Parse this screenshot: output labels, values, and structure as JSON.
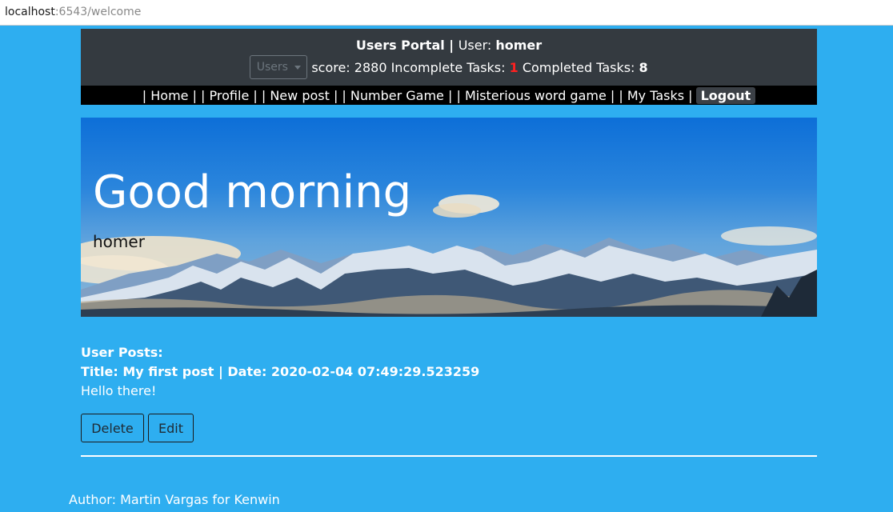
{
  "browser": {
    "url_host": "localhost",
    "url_rest": ":6543/welcome"
  },
  "header": {
    "portal_title": "Users Portal",
    "separator": " | ",
    "user_label": "User: ",
    "username": "homer",
    "users_dropdown": "Users",
    "score_label": "score: ",
    "score_value": "2880",
    "incomplete_label": " Incomplete Tasks: ",
    "incomplete_value": "1",
    "completed_label": " Completed Tasks: ",
    "completed_value": "8"
  },
  "nav": {
    "items": [
      "| Home |",
      " | Profile |",
      " | New post |",
      " | Number Game |",
      " | Misterious word game |",
      " | My Tasks |"
    ],
    "logout": "Logout"
  },
  "hero": {
    "greeting": "Good morning",
    "name": "homer"
  },
  "posts": {
    "label": "User Posts:",
    "items": [
      {
        "title_line": "Title: My first post | Date: 2020-02-04 07:49:29.523259",
        "body": "Hello there!"
      }
    ],
    "delete_label": "Delete",
    "edit_label": "Edit"
  },
  "footer": {
    "author": "Author: Martin Vargas for Kenwin"
  },
  "colors": {
    "page_bg": "#2eaef0",
    "header_bg": "#343a40",
    "nav_bg": "#000000",
    "incomplete": "#ff2020"
  }
}
